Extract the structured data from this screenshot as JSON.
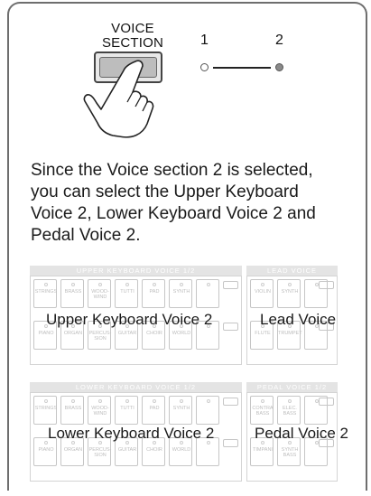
{
  "voice_section": {
    "label_line1": "VOICE",
    "label_line2": "SECTION",
    "number_1": "1",
    "number_2": "2"
  },
  "caption": "Since the Voice section 2 is selected, you can select the Upper Keyboard Voice 2, Lower Keyboard Voice 2 and Pedal Voice 2.",
  "panels": {
    "upper_header": "UPPER KEYBOARD VOICE 1/2",
    "lead_header": "LEAD VOICE",
    "lower_header": "LOWER KEYBOARD VOICE 1/2",
    "pedal_header": "PEDAL VOICE 1/2",
    "upper_overlay": "Upper Keyboard Voice 2",
    "lead_overlay": "Lead Voice",
    "lower_overlay": "Lower Keyboard Voice 2",
    "pedal_overlay": "Pedal Voice 2"
  },
  "keyboard_top_labels": [
    "STRINGS",
    "BRASS",
    "WOOD-WIND",
    "TUTTI",
    "PAD",
    "SYNTH"
  ],
  "keyboard_bottom_labels": [
    "PIANO",
    "ORGAN",
    "PERCUS-SION",
    "GUITAR",
    "CHOIR",
    "WORLD"
  ],
  "lead_top_labels": [
    "VIOLIN",
    "SYNTH"
  ],
  "lead_bottom_labels": [
    "FLUTE",
    "TRUMPET"
  ],
  "pedal_top_labels": [
    "CONTRA BASS",
    "ELEC. BASS"
  ],
  "pedal_bottom_labels": [
    "TIMPANI",
    "SYNTH BASS"
  ],
  "colors": {
    "frame": "#6e6e6e",
    "selected_led": "#8a8a8a",
    "panel_faint": "#c6c6c6"
  }
}
